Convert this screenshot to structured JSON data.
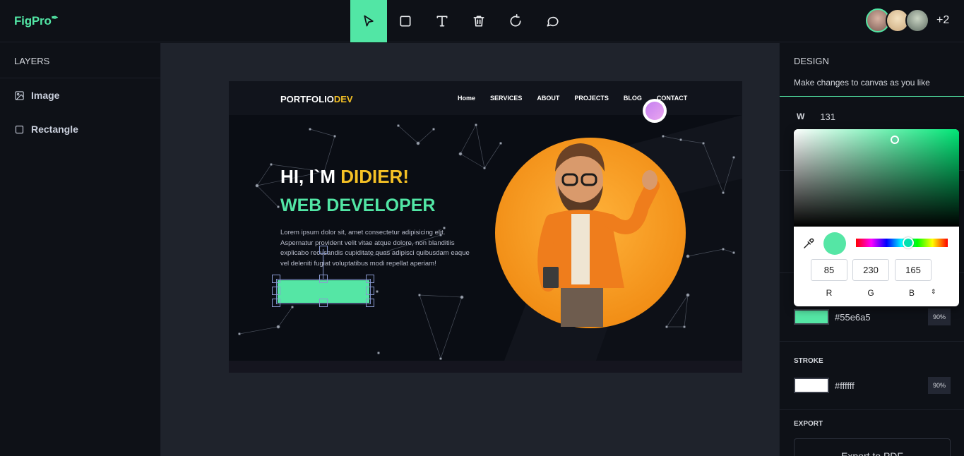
{
  "app": {
    "logo": "FigPro"
  },
  "toolbar": {
    "tools": [
      "select",
      "rectangle",
      "text",
      "delete",
      "reset",
      "comment"
    ],
    "active_tool": "select",
    "accent": "#52e6a5"
  },
  "users": {
    "more_label": "+2"
  },
  "layers": {
    "title": "LAYERS",
    "items": [
      {
        "label": "Image",
        "icon": "image-icon"
      },
      {
        "label": "Rectangle",
        "icon": "square-icon"
      }
    ]
  },
  "artboard": {
    "brand_main": "PORTFOLIO",
    "brand_accent": "DEV",
    "nav": [
      "Home",
      "SERVICES",
      "ABOUT",
      "PROJECTS",
      "BLOG",
      "CONTACT"
    ],
    "greeting": "HI, I`M ",
    "name": "DIDIER!",
    "role": "WEB DEVELOPER",
    "paragraph": "Lorem ipsum dolor sit, amet consectetur adipisicing elit. Aspernatur provident velit vitae atque dolore, non blanditiis explicabo recusandis cupiditate quas adipisci quibusdam eaque vel deleniti fugiat voluptatibus modi repellat aperiam!",
    "cta_color": "#55e6a5"
  },
  "design": {
    "title": "DESIGN",
    "subtitle": "Make changes to canvas as you like",
    "width_label": "W",
    "width_value": "131",
    "fill": {
      "hex": "#55e6a5",
      "opacity": "90%"
    },
    "stroke": {
      "title": "STROKE",
      "hex": "#ffffff",
      "opacity": "90%"
    },
    "export": {
      "title": "EXPORT",
      "button": "Export to PDF"
    }
  },
  "picker": {
    "r": "85",
    "g": "230",
    "b": "165",
    "r_label": "R",
    "g_label": "G",
    "b_label": "B",
    "mode_switch": "⇕"
  }
}
